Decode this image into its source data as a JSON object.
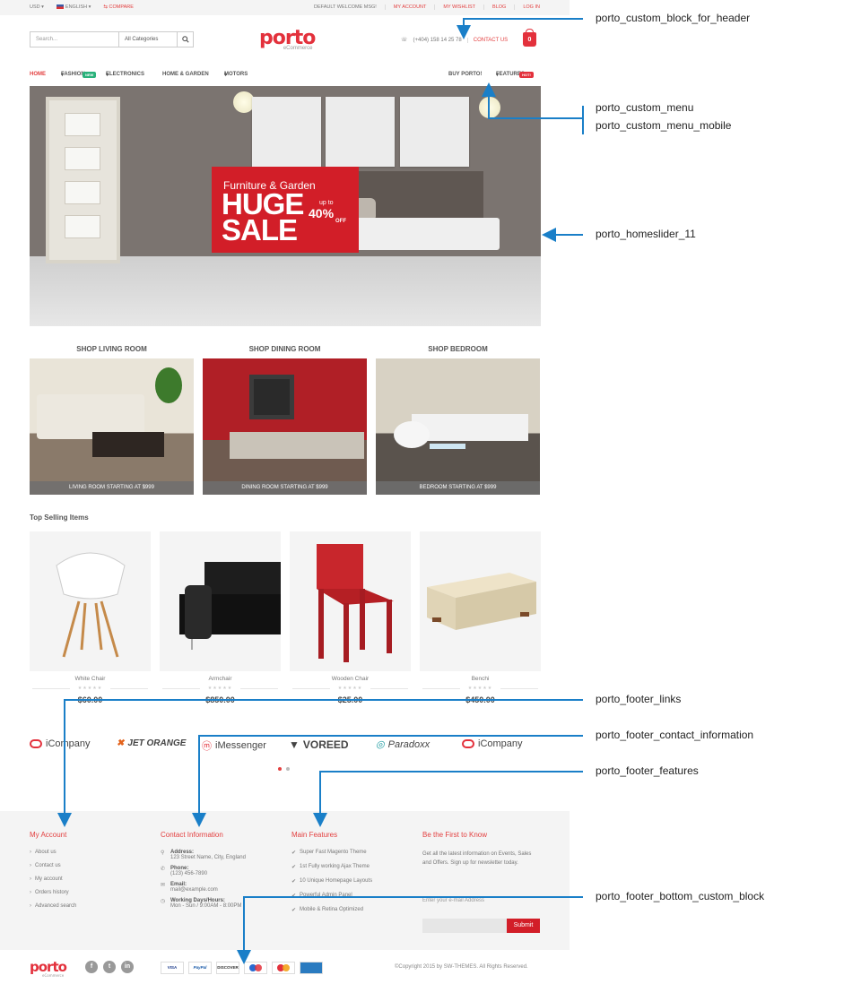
{
  "topbar": {
    "currency": "USD",
    "language": "ENGLISH",
    "compare": "COMPARE",
    "welcome": "DEFAULT WELCOME MSG!",
    "links": [
      "MY ACCOUNT",
      "MY WISHLIST",
      "BLOG",
      "LOG IN"
    ]
  },
  "header": {
    "search_placeholder": "Search...",
    "category": "All Categories",
    "logo": "porto",
    "logo_sub": "eCommerce",
    "phone": "(+404) 158 14 25 78",
    "contact": "CONTACT US",
    "cart_count": "0"
  },
  "nav": {
    "items": [
      "HOME",
      "FASHION",
      "ELECTRONICS",
      "HOME & GARDEN",
      "MOTORS"
    ],
    "right": [
      "BUY PORTO!",
      "FEATURES"
    ],
    "badge_new": "NEW",
    "badge_hot": "HOT!"
  },
  "hero": {
    "line1": "Furniture & Garden",
    "line2": "HUGE",
    "line3": "SALE",
    "upto": "up to",
    "pct": "40%",
    "off": "OFF"
  },
  "categories": [
    {
      "title": "SHOP LIVING ROOM",
      "caption": "LIVING ROOM STARTING AT $999"
    },
    {
      "title": "SHOP DINING ROOM",
      "caption": "DINING ROOM STARTING AT $999"
    },
    {
      "title": "SHOP BEDROOM",
      "caption": "BEDROOM STARTING AT $999"
    }
  ],
  "top_selling": {
    "heading": "Top Selling Items",
    "products": [
      {
        "name": "White Chair",
        "price": "$60.00"
      },
      {
        "name": "Armchair",
        "price": "$850.00"
      },
      {
        "name": "Wooden Chair",
        "price": "$25.00"
      },
      {
        "name": "Benchi",
        "price": "$450.00"
      }
    ]
  },
  "brands": [
    "iCompany",
    "JET ORANGE",
    "iMessenger",
    "VOREED",
    "Paradoxx",
    "iCompany"
  ],
  "footer": {
    "account": {
      "heading": "My Account",
      "links": [
        "About us",
        "Contact us",
        "My account",
        "Orders history",
        "Advanced search"
      ]
    },
    "contact": {
      "heading": "Contact Information",
      "items": [
        {
          "label": "Address:",
          "value": "123 Street Name, City, England"
        },
        {
          "label": "Phone:",
          "value": "(123) 456-7890"
        },
        {
          "label": "Email:",
          "value": "mail@example.com"
        },
        {
          "label": "Working Days/Hours:",
          "value": "Mon - Sun / 9:00AM - 8:00PM"
        }
      ]
    },
    "features": {
      "heading": "Main Features",
      "items": [
        "Super Fast Magento Theme",
        "1st Fully working Ajax Theme",
        "10 Unique Homepage Layouts",
        "Powerful Admin Panel",
        "Mobile & Retina Optimized"
      ]
    },
    "newsletter": {
      "heading": "Be the First to Know",
      "text": "Get all the latest information on Events, Sales and Offers. Sign up for newsletter today.",
      "email_label": "Enter your e-mail Address",
      "button": "Submit"
    }
  },
  "bottom": {
    "logo": "porto",
    "logo_sub": "eCommerce",
    "payments": [
      "VISA",
      "PayPal",
      "DISCOVER",
      "",
      "",
      ""
    ],
    "copyright": "©Copyright 2015 by SW-THEMES. All Rights Reserved."
  },
  "annotations": [
    "porto_custom_block_for_header",
    "porto_custom_menu",
    "porto_custom_menu_mobile",
    "porto_homeslider_11",
    "porto_footer_links",
    "porto_footer_contact_information",
    "porto_footer_features",
    "porto_footer_bottom_custom_block"
  ]
}
